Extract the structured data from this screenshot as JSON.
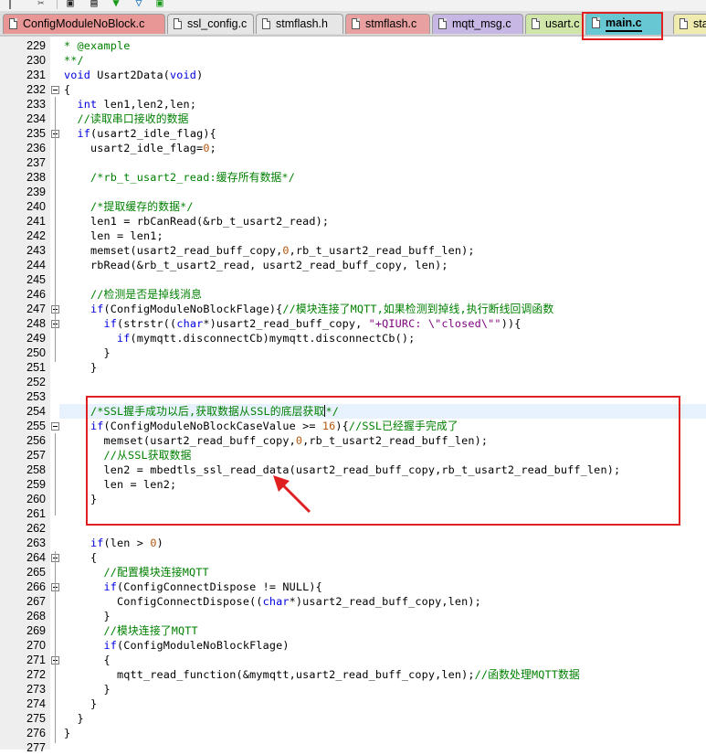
{
  "tabs": [
    {
      "label": "ConfigModuleNoBlock.c",
      "color": "#e89696"
    },
    {
      "label": "ssl_config.c",
      "color": "#e6e6e6"
    },
    {
      "label": "stmflash.h",
      "color": "#e6e6e6"
    },
    {
      "label": "stmflash.c",
      "color": "#e8a0a0"
    },
    {
      "label": "mqtt_msg.c",
      "color": "#c6b7e4"
    },
    {
      "label": "usart.c",
      "color": "#cfe6a8"
    },
    {
      "label": "main.c",
      "color": "#67c8d4",
      "active": true
    },
    {
      "label": "star",
      "color": "#f0ecb0"
    }
  ],
  "lines": [
    {
      "n": "229",
      "html": "<span class=\"cm\">* @example</span>"
    },
    {
      "n": "230",
      "html": "<span class=\"cm\">**/</span>"
    },
    {
      "n": "231",
      "html": "<span class=\"kw\">void</span> Usart2Data(<span class=\"kw\">void</span>)"
    },
    {
      "n": "232",
      "html": "{"
    },
    {
      "n": "233",
      "html": "  <span class=\"kw\">int</span> len1,len2,len;"
    },
    {
      "n": "234",
      "html": "  <span class=\"cm\">//读取串口接收的数据</span>"
    },
    {
      "n": "235",
      "html": "  <span class=\"kw\">if</span>(usart2_idle_flag){"
    },
    {
      "n": "236",
      "html": "    usart2_idle_flag=<span class=\"num\">0</span>;"
    },
    {
      "n": "237",
      "html": ""
    },
    {
      "n": "238",
      "html": "    <span class=\"cm\">/*rb_t_usart2_read:缓存所有数据*/</span>"
    },
    {
      "n": "239",
      "html": ""
    },
    {
      "n": "240",
      "html": "    <span class=\"cm\">/*提取缓存的数据*/</span>"
    },
    {
      "n": "241",
      "html": "    len1 = rbCanRead(&amp;rb_t_usart2_read);"
    },
    {
      "n": "242",
      "html": "    len = len1;"
    },
    {
      "n": "243",
      "html": "    memset(usart2_read_buff_copy,<span class=\"num\">0</span>,rb_t_usart2_read_buff_len);"
    },
    {
      "n": "244",
      "html": "    rbRead(&amp;rb_t_usart2_read, usart2_read_buff_copy, len);"
    },
    {
      "n": "245",
      "html": ""
    },
    {
      "n": "246",
      "html": "    <span class=\"cm\">//检测是否是掉线消息</span>"
    },
    {
      "n": "247",
      "html": "    <span class=\"kw\">if</span>(ConfigModuleNoBlockFlage){<span class=\"cm\">//模块连接了MQTT,如果检测到掉线,执行断线回调函数</span>"
    },
    {
      "n": "248",
      "html": "      <span class=\"kw\">if</span>(strstr((<span class=\"kw\">char</span>*)usart2_read_buff_copy, <span class=\"str\">\"+QIURC: \\\"closed\\\"\"</span>)){"
    },
    {
      "n": "249",
      "html": "        <span class=\"kw\">if</span>(mymqtt.disconnectCb)mymqtt.disconnectCb();"
    },
    {
      "n": "250",
      "html": "      }"
    },
    {
      "n": "251",
      "html": "    }"
    },
    {
      "n": "252",
      "html": ""
    },
    {
      "n": "253",
      "html": ""
    },
    {
      "n": "254",
      "html": "    <span class=\"cm\">/*SSL握手成功以后,获取数据从SSL的底层获取</span><span class=\"cursor\"></span><span class=\"cm\">*/</span>",
      "hl": true
    },
    {
      "n": "255",
      "html": "    <span class=\"kw\">if</span>(ConfigModuleNoBlockCaseValue &gt;= <span class=\"num\">16</span>){<span class=\"cm\">//SSL已经握手完成了</span>"
    },
    {
      "n": "256",
      "html": "      memset(usart2_read_buff_copy,<span class=\"num\">0</span>,rb_t_usart2_read_buff_len);"
    },
    {
      "n": "257",
      "html": "      <span class=\"cm\">//从SSL获取数据</span>"
    },
    {
      "n": "258",
      "html": "      len2 = mbedtls_ssl_read_data(usart2_read_buff_copy,rb_t_usart2_read_buff_len);"
    },
    {
      "n": "259",
      "html": "      len = len2;"
    },
    {
      "n": "260",
      "html": "    }"
    },
    {
      "n": "261",
      "html": ""
    },
    {
      "n": "262",
      "html": ""
    },
    {
      "n": "263",
      "html": "    <span class=\"kw\">if</span>(len &gt; <span class=\"num\">0</span>)"
    },
    {
      "n": "264",
      "html": "    {"
    },
    {
      "n": "265",
      "html": "      <span class=\"cm\">//配置模块连接MQTT</span>"
    },
    {
      "n": "266",
      "html": "      <span class=\"kw\">if</span>(ConfigConnectDispose != NULL){"
    },
    {
      "n": "267",
      "html": "        ConfigConnectDispose((<span class=\"kw\">char</span>*)usart2_read_buff_copy,len);"
    },
    {
      "n": "268",
      "html": "      }"
    },
    {
      "n": "269",
      "html": "      <span class=\"cm\">//模块连接了MQTT</span>"
    },
    {
      "n": "270",
      "html": "      <span class=\"kw\">if</span>(ConfigModuleNoBlockFlage)"
    },
    {
      "n": "271",
      "html": "      {"
    },
    {
      "n": "272",
      "html": "        mqtt_read_function(&amp;mymqtt,usart2_read_buff_copy,len);<span class=\"cm\">//函数处理MQTT数据</span>"
    },
    {
      "n": "273",
      "html": "      }"
    },
    {
      "n": "274",
      "html": "    }"
    },
    {
      "n": "275",
      "html": "  }"
    },
    {
      "n": "276",
      "html": "}"
    },
    {
      "n": "277",
      "html": ""
    }
  ],
  "colors": {
    "keyword": "#0000e0",
    "comment": "#008000",
    "string": "#7f007f",
    "number": "#b5550b",
    "highlight": "#e8f2fe",
    "annotation": "#e02020"
  }
}
